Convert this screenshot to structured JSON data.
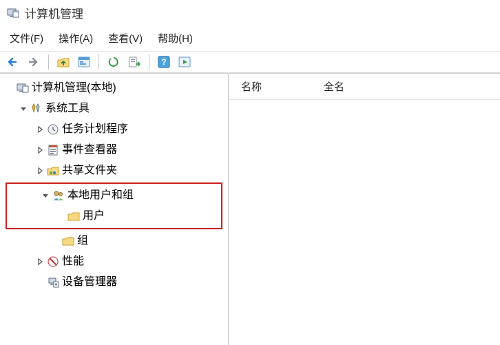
{
  "window": {
    "title": "计算机管理"
  },
  "menu": {
    "file": "文件(F)",
    "action": "操作(A)",
    "view": "查看(V)",
    "help": "帮助(H)"
  },
  "toolbar_icons": {
    "back": "back-icon",
    "forward": "forward-icon",
    "up": "up-folder-icon",
    "properties": "properties-icon",
    "refresh": "refresh-icon",
    "export": "export-list-icon",
    "help": "help-icon",
    "run": "run-icon"
  },
  "tree": {
    "root": {
      "label": "计算机管理(本地)"
    },
    "systemTools": {
      "label": "系统工具"
    },
    "taskScheduler": {
      "label": "任务计划程序"
    },
    "eventViewer": {
      "label": "事件查看器"
    },
    "sharedFolders": {
      "label": "共享文件夹"
    },
    "localUsersGroups": {
      "label": "本地用户和组"
    },
    "users": {
      "label": "用户"
    },
    "groups": {
      "label": "组"
    },
    "performance": {
      "label": "性能"
    },
    "deviceManager": {
      "label": "设备管理器"
    }
  },
  "listHeaders": {
    "name": "名称",
    "fullName": "全名"
  }
}
